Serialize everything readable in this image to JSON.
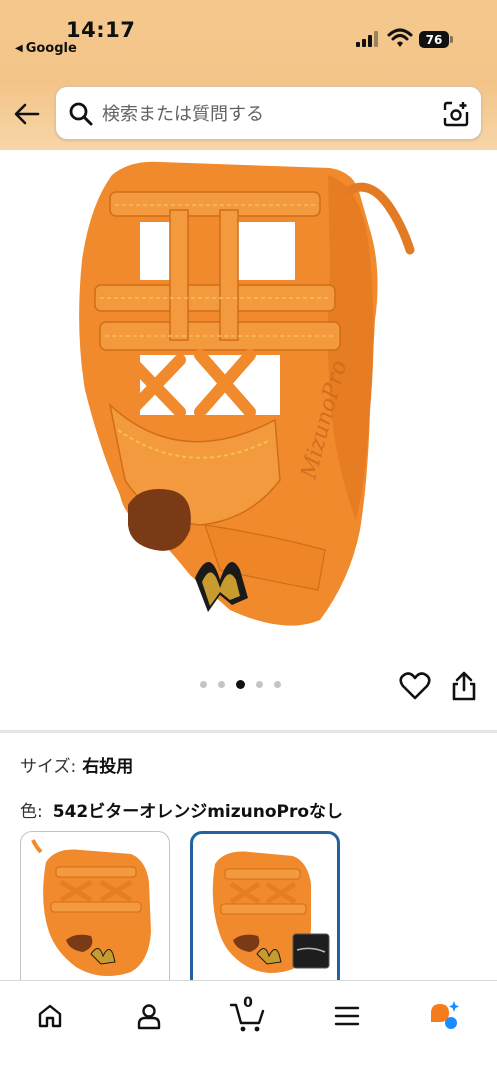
{
  "status_bar": {
    "time": "14:17",
    "back_app": "Google",
    "battery": "76"
  },
  "search": {
    "placeholder": "検索または質問する"
  },
  "gallery": {
    "image_count": 5,
    "active_index": 2,
    "image_alt_icon": "baseball-glove"
  },
  "variations": {
    "size_label": "サイズ:",
    "size_value": "右投用",
    "color_label": "色:",
    "color_value": "542ビターオレンジmizunoProなし",
    "swatches": [
      {
        "name": "glove-only",
        "selected": false
      },
      {
        "name": "glove-with-bag",
        "selected": true
      }
    ]
  },
  "bottom_nav": {
    "cart_count": "0",
    "items": [
      "home-icon",
      "account-icon",
      "cart-icon",
      "menu-icon",
      "assistant-icon"
    ]
  },
  "colors": {
    "header_bg": "#f3c488",
    "glove_orange": "#f08a2c",
    "selected_border": "#2162a1"
  }
}
